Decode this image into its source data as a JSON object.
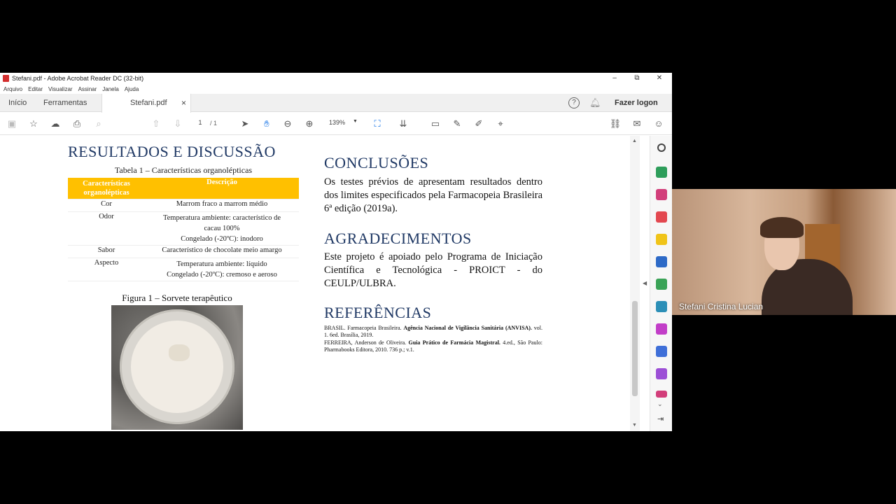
{
  "window": {
    "title": "Stefani.pdf - Adobe Acrobat Reader DC (32-bit)",
    "controls": {
      "minimize": "–",
      "maximize": "⧉",
      "close": "✕"
    }
  },
  "menu": [
    "Arquivo",
    "Editar",
    "Visualizar",
    "Assinar",
    "Janela",
    "Ajuda"
  ],
  "tabs": {
    "home": "Início",
    "tools": "Ferramentas",
    "doc": "Stefani.pdf",
    "close": "×"
  },
  "header_right": {
    "login": "Fazer logon"
  },
  "toolbar": {
    "page_current": "1",
    "page_total": "/ 1",
    "zoom": "139%"
  },
  "document": {
    "left": {
      "heading": "RESULTADOS E DISCUSSÃO",
      "table_caption": "Tabela 1 – Características organolépticas",
      "table_header": [
        "Características organolépticas",
        "Descrição"
      ],
      "rows": [
        {
          "c": "Cor",
          "d": [
            "Marrom fraco a marrom médio"
          ]
        },
        {
          "c": "Odor",
          "d": [
            "Temperatura ambiente: característico de",
            "cacau 100%",
            "Congelado (-20ºC): inodoro"
          ]
        },
        {
          "c": "Sabor",
          "d": [
            "Característico de chocolate meio amargo"
          ]
        },
        {
          "c": "Aspecto",
          "d": [
            "Temperatura ambiente: líquido",
            "Congelado (-20ºC): cremoso e aeroso"
          ]
        }
      ],
      "figure_caption": "Figura 1 – Sorvete terapêutico"
    },
    "right": {
      "conc_heading": "CONCLUSÕES",
      "conc_text": "Os testes prévios de apresentam resultados dentro dos limites especificados pela Farmacopeia Brasileira 6ª edição (2019a).",
      "agr_heading": "AGRADECIMENTOS",
      "agr_text": "Este projeto é apoiado pelo Programa de Iniciação Científica e Tecnológica - PROICT - do CEULP/ULBRA.",
      "ref_heading": "REFERÊNCIAS",
      "ref1_plain": "BRASIL. Farmacopeia Brasileira.",
      "ref1_bold": "Agência Nacional de Vigilância Sanitária (ANVISA).",
      "ref1_end": "vol. 1. 6ed. Brasília, 2019.",
      "ref2_plain": "FERREIRA, Anderson de Oliveira.",
      "ref2_bold": "Guia Prático de Farmácia Magistral.",
      "ref2_end": "4.ed., São Paulo: Pharmabooks Editora, 2010. 736 p.; v.1."
    }
  },
  "video": {
    "participant": "Stefani Cristina Lucian"
  },
  "colors": {
    "heading": "#1f3864",
    "table_header_bg": "#ffc000"
  }
}
